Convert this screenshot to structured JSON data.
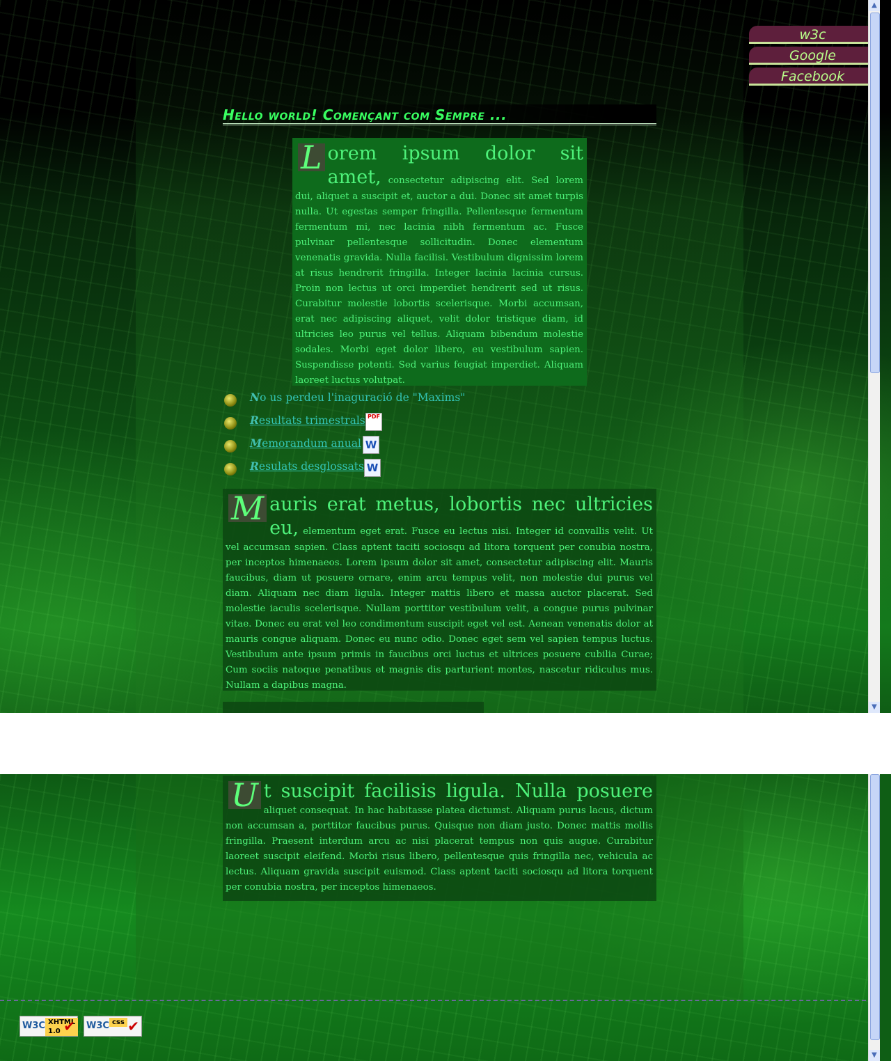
{
  "nav": {
    "links": [
      "w3c",
      "Google",
      "Facebook"
    ]
  },
  "page": {
    "title": "Hello world! Començant com Sempre ..."
  },
  "paragraphs": [
    {
      "initial": "L",
      "lead": "orem ipsum dolor sit amet,",
      "body": "consectetur adipiscing elit. Sed lorem dui, aliquet a suscipit et, auctor a dui. Donec sit amet turpis nulla. Ut egestas semper fringilla. Pellentesque fermentum fermentum mi, nec lacinia nibh fermentum ac. Fusce pulvinar pellentesque sollicitudin. Donec elementum venenatis gravida. Nulla facilisi. Vestibulum dignissim lorem at risus hendrerit fringilla. Integer lacinia lacinia cursus. Proin non lectus ut orci imperdiet hendrerit sed ut risus. Curabitur molestie lobortis scelerisque. Morbi accumsan, erat nec adipiscing aliquet, velit dolor tristique diam, id ultricies leo purus vel tellus. Aliquam bibendum molestie sodales. Morbi eget dolor libero, eu vestibulum sapien. Suspendisse potenti. Sed varius feugiat imperdiet. Aliquam laoreet luctus volutpat."
    },
    {
      "initial": "M",
      "lead": "auris erat metus, lobortis nec ultricies eu,",
      "body": "elementum eget erat. Fusce eu lectus nisi. Integer id convallis velit. Ut vel accumsan sapien. Class aptent taciti sociosqu ad litora torquent per conubia nostra, per inceptos himenaeos. Lorem ipsum dolor sit amet, consectetur adipiscing elit. Mauris faucibus, diam ut posuere ornare, enim arcu tempus velit, non molestie dui purus vel diam. Aliquam nec diam ligula. Integer mattis libero et massa auctor placerat. Sed molestie iaculis scelerisque. Nullam porttitor vestibulum velit, a congue purus pulvinar vitae. Donec eu erat vel leo condimentum suscipit eget vel est. Aenean venenatis dolor at mauris congue aliquam. Donec eu nunc odio. Donec eget sem vel sapien tempus luctus. Vestibulum ante ipsum primis in faucibus orci luctus et ultrices posuere cubilia Curae; Cum sociis natoque penatibus et magnis dis parturient montes, nascetur ridiculus mus. Nullam a dapibus magna."
    },
    {
      "initial": "U",
      "lead": "t suscipit facilisis ligula. Nulla posuere",
      "body": "aliquet consequat. In hac habitasse platea dictumst. Aliquam purus lacus, dictum non accumsan a, porttitor faucibus purus. Quisque non diam justo. Donec mattis mollis fringilla. Praesent interdum arcu ac nisi placerat tempus non quis augue. Curabitur laoreet suscipit eleifend. Morbi risus libero, pellentesque quis fringilla nec, vehicula ac lectus. Aliquam gravida suscipit euismod. Class aptent taciti sociosqu ad litora torquent per conubia nostra, per inceptos himenaeos."
    }
  ],
  "items": [
    {
      "initial": "N",
      "text": "o us perdeu l'inaguració de \"Maxims\"",
      "icon": "none"
    },
    {
      "initial": "R",
      "text": "esultats trimestrals",
      "icon": "pdf-icon"
    },
    {
      "initial": "M",
      "text": "emorandum anual",
      "icon": "word-doc-icon"
    },
    {
      "initial": "R",
      "text": "esulats desglossats",
      "icon": "word-doc-icon"
    }
  ],
  "icon_labels": {
    "pdf": "PDF",
    "doc": "W"
  },
  "badges": [
    {
      "w3c": "W3C",
      "label": "XHTML 1.0"
    },
    {
      "w3c": "W3C",
      "label": "css"
    }
  ],
  "colors": {
    "accent": "#39ff61",
    "nav_bg": "#5e1f3c",
    "link": "#33c4b4"
  }
}
